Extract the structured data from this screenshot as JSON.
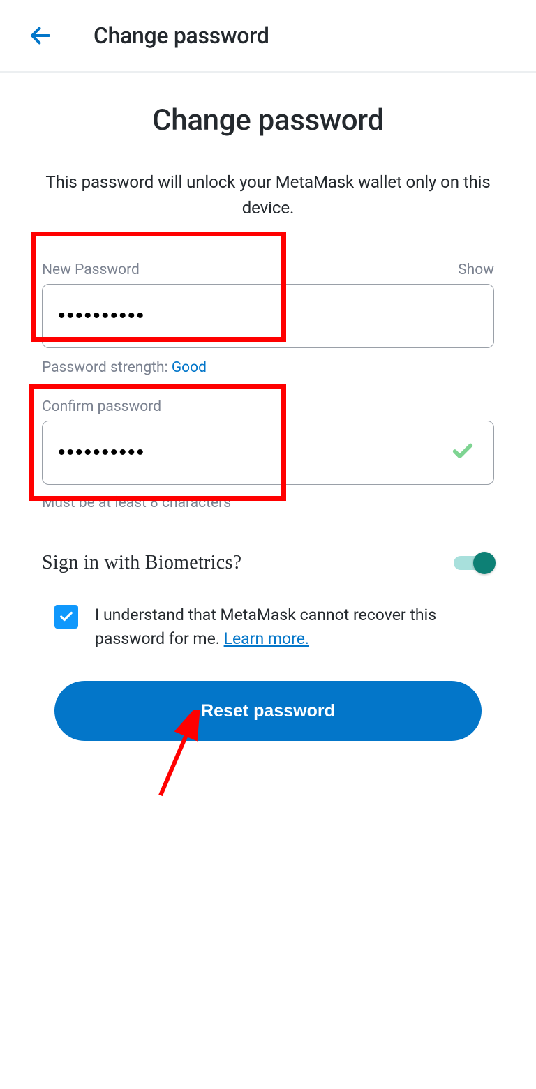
{
  "header": {
    "title": "Change password"
  },
  "page": {
    "heading": "Change password",
    "subtitle": "This password will unlock your MetaMask wallet only on this device."
  },
  "new_password": {
    "label": "New Password",
    "show": "Show",
    "value": "••••••••••",
    "strength_label": "Password strength: ",
    "strength_value": "Good"
  },
  "confirm_password": {
    "label": "Confirm password",
    "value": "••••••••••",
    "hint": "Must be at least 8 characters"
  },
  "biometrics": {
    "label": "Sign in with Biometrics?"
  },
  "consent": {
    "text": "I understand that MetaMask cannot recover this password for me. ",
    "learn_more": "Learn more."
  },
  "reset": {
    "label": "Reset password"
  }
}
